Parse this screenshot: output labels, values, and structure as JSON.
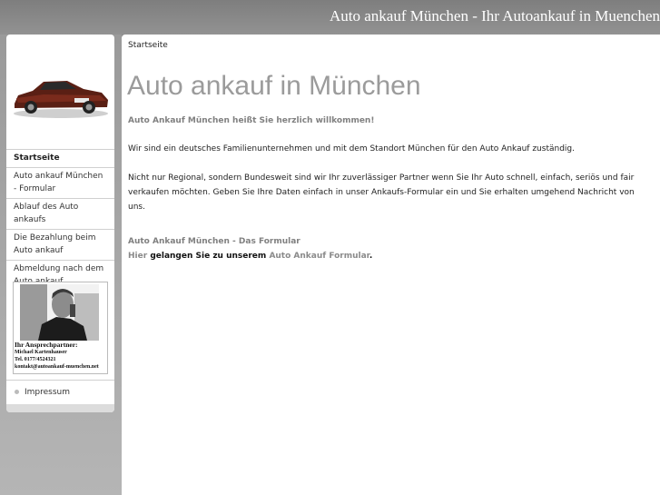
{
  "header": {
    "site_title": "Auto ankauf München - Ihr Autoankauf in Muenchen"
  },
  "sidebar": {
    "nav": [
      {
        "label": "Startseite",
        "active": true
      },
      {
        "label": "Auto ankauf München - Formular"
      },
      {
        "label": "Ablauf des Auto ankaufs"
      },
      {
        "label": "Die Bezahlung beim Auto ankauf"
      },
      {
        "label": "Abmeldung nach dem Auto ankauf"
      }
    ],
    "contact": {
      "title": "Ihr Ansprechpartner:",
      "name": "Michael Kartenhauser",
      "phone": "Tel. 0177/4524321",
      "email": "kontakt@autoankauf-muenchen.net"
    },
    "impressum": "Impressum"
  },
  "main": {
    "breadcrumb": "Startseite",
    "title": "Auto ankauf in München",
    "welcome": "Auto Ankauf München heißt Sie herzlich willkommen!",
    "p1": "Wir sind ein deutsches Familienunternehmen und mit dem Standort München für den Auto Ankauf zuständig.",
    "p2": "Nicht nur Regional, sondern Bundesweit sind wir Ihr zuverlässiger Partner wenn Sie Ihr Auto schnell, einfach, seriös und fair verkaufen möchten. Geben Sie Ihre Daten einfach in unser Ankaufs-Formular ein und Sie erhalten umgehend Nachricht von uns.",
    "subhead": "Auto Ankauf München - Das Formular",
    "link_line": {
      "part1": "Hier",
      "part2": "gelangen Sie zu unserem",
      "part3": "Auto Ankauf Formular",
      "part4": "."
    }
  },
  "colors": {
    "title_grey": "#9b9b9b",
    "background": "#8a8a8a"
  }
}
